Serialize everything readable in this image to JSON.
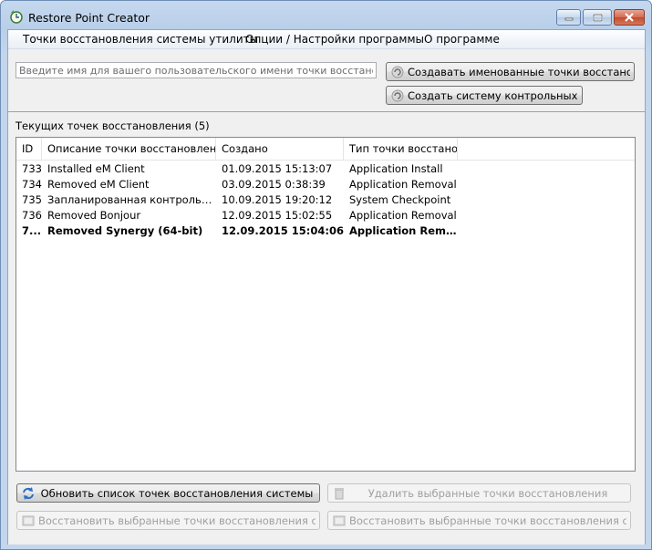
{
  "window": {
    "title": "Restore Point Creator"
  },
  "menu": [
    {
      "label": "Точки восстановления системы утилиты"
    },
    {
      "label": "Опции / Настройки программы"
    },
    {
      "label": "О программе"
    }
  ],
  "create": {
    "name_placeholder": "Введите имя для вашего пользовательского имени точки восстановления си",
    "named_button": "Создавать именованные точки восстановления",
    "checkpoint_button": "Создать систему контрольных точек"
  },
  "list": {
    "section_label": "Текущих точек восстановления (5)",
    "columns": [
      "ID",
      "Описание точки восстановления",
      "Создано",
      "Тип точки восстано..."
    ],
    "rows": [
      {
        "id": "733",
        "description": "Installed eM Client",
        "created": "01.09.2015 15:13:07",
        "type": "Application Install",
        "bold": false
      },
      {
        "id": "734",
        "description": "Removed eM Client",
        "created": "03.09.2015 0:38:39",
        "type": "Application Removal",
        "bold": false
      },
      {
        "id": "735",
        "description": "Запланированная контрольная т...",
        "created": "10.09.2015 19:20:12",
        "type": "System Checkpoint",
        "bold": false
      },
      {
        "id": "736",
        "description": "Removed Bonjour",
        "created": "12.09.2015 15:02:55",
        "type": "Application Removal",
        "bold": false
      },
      {
        "id": "7...",
        "description": "Removed Synergy (64-bit)",
        "created": "12.09.2015 15:04:06",
        "type": "Application Remo...",
        "bold": true
      }
    ]
  },
  "actions": {
    "refresh": "Обновить список точек восстановления системы",
    "delete": "Удалить выбранные точки восстановления",
    "restore": "Восстановить выбранные точки восстановления системы",
    "restore_safe": "Восстановить выбранные точки восстановления системы в"
  }
}
